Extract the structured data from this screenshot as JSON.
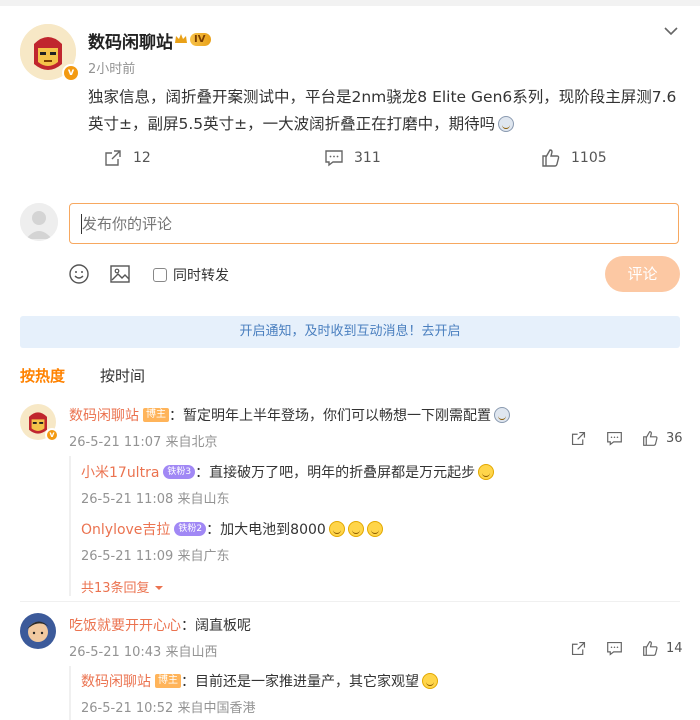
{
  "post": {
    "author": "数码闲聊站",
    "level": "IV",
    "time": "2小时前",
    "content": "独家信息，阔折叠开案测试中，平台是2nm骁龙8 Elite Gen6系列，现阶段主屏测7.6英寸±，副屏5.5英寸±，一大波阔折叠正在打磨中，期待吗",
    "repost_count": "12",
    "comment_count": "311",
    "like_count": "1105"
  },
  "composer": {
    "placeholder": "发布你的评论",
    "repost_label": "同时转发",
    "submit_label": "评论"
  },
  "notice": "开启通知，及时收到互动消息！去开启",
  "sort": {
    "hot": "按热度",
    "time": "按时间"
  },
  "comments": [
    {
      "author": "数码闲聊站",
      "tag": "博主",
      "text": "：暂定明年上半年登场，你们可以畅想一下刚需配置",
      "meta": "26-5-21 11:07 来自北京",
      "likes": "36",
      "replies": [
        {
          "author": "小米17ultra",
          "tag": "铁粉3",
          "text": "：直接破万了吧，明年的折叠屏都是万元起步",
          "meta": "26-5-21 11:08 来自山东"
        },
        {
          "author": "Onlylove吉拉",
          "tag": "铁粉2",
          "text": "：加大电池到8000",
          "meta": "26-5-21 11:09 来自广东"
        }
      ],
      "more_replies": "共13条回复"
    },
    {
      "author": "吃饭就要开开心心",
      "text": "：阔直板呢",
      "meta": "26-5-21 10:43 来自山西",
      "likes": "14",
      "replies": [
        {
          "author": "数码闲聊站",
          "tag": "博主",
          "text": "：目前还是一家推进量产，其它家观望",
          "meta": "26-5-21 10:52 来自中国香港"
        }
      ]
    }
  ],
  "colors": {
    "accent": "#ff8200",
    "username": "#eb7350",
    "notice_bg": "#e6f0fb",
    "submit_bg": "#fcc8a3"
  }
}
